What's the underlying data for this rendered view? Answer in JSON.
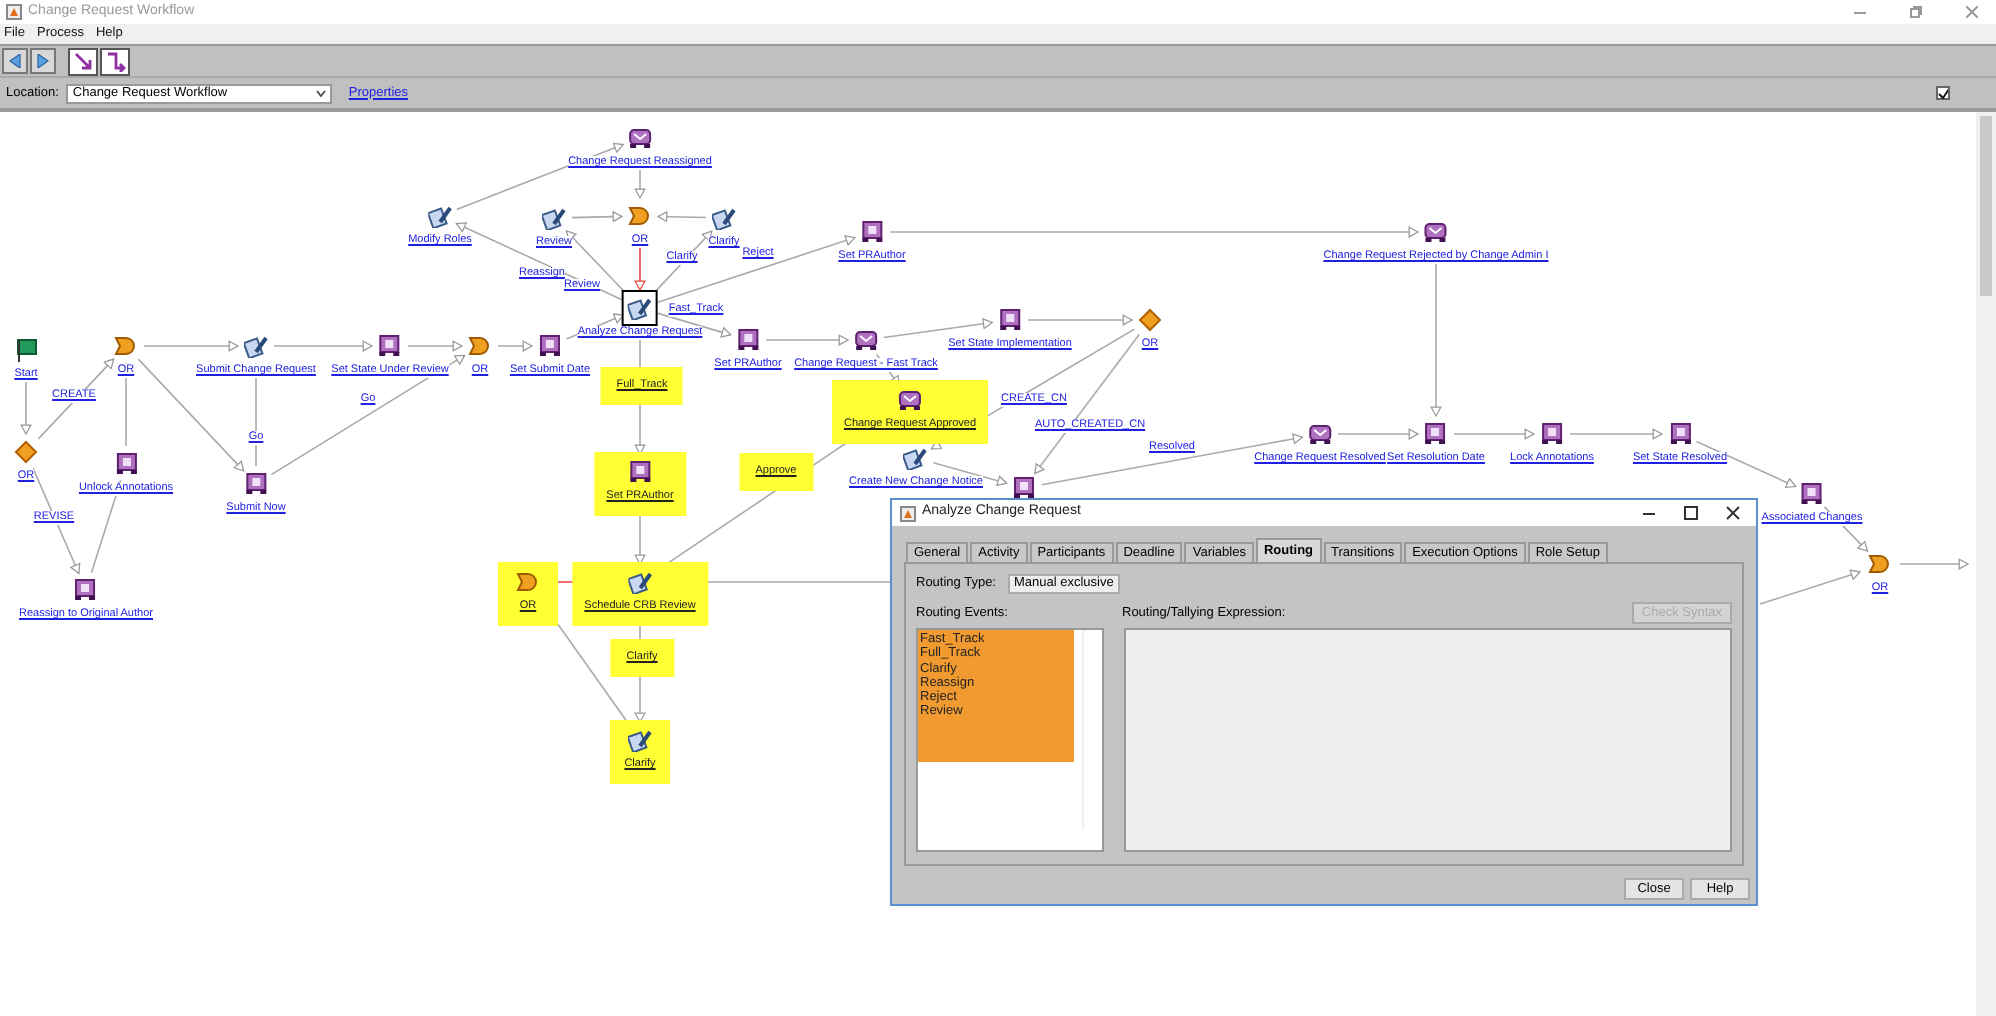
{
  "window": {
    "title": "Change Request Workflow"
  },
  "menu": [
    "File",
    "Process",
    "Help"
  ],
  "location": {
    "label": "Location:",
    "value": "Change Request Workflow",
    "link": "Properties",
    "option_checked": true
  },
  "nodes": [
    {
      "label": "Change Request Reassigned",
      "kind": "notify",
      "highlighted": false,
      "selected": false
    },
    {
      "label": "Modify Roles",
      "kind": "activity",
      "highlighted": false,
      "selected": false
    },
    {
      "label": "Review",
      "kind": "activity",
      "highlighted": false,
      "selected": false
    },
    {
      "label": "OR",
      "kind": "or",
      "highlighted": false,
      "selected": false
    },
    {
      "label": "Clarify",
      "kind": "activity",
      "highlighted": false,
      "selected": false
    },
    {
      "label": "Set PRAuthor",
      "kind": "robot",
      "highlighted": false,
      "selected": false
    },
    {
      "label": "Change Request Rejected by Change Admin I",
      "kind": "notify",
      "highlighted": false,
      "selected": false
    },
    {
      "label": "Analyze Change Request",
      "kind": "activity",
      "highlighted": false,
      "selected": true
    },
    {
      "label": "Set State Implementation",
      "kind": "robot",
      "highlighted": false,
      "selected": false
    },
    {
      "label": "OR",
      "kind": "branch",
      "highlighted": false,
      "selected": false
    },
    {
      "label": "Start",
      "kind": "start",
      "highlighted": false,
      "selected": false
    },
    {
      "label": "OR",
      "kind": "or",
      "highlighted": false,
      "selected": false
    },
    {
      "label": "Submit Change Request",
      "kind": "activity",
      "highlighted": false,
      "selected": false
    },
    {
      "label": "Set State Under Review",
      "kind": "robot",
      "highlighted": false,
      "selected": false
    },
    {
      "label": "OR",
      "kind": "or",
      "highlighted": false,
      "selected": false
    },
    {
      "label": "Set Submit Date",
      "kind": "robot",
      "highlighted": false,
      "selected": false
    },
    {
      "label": "Set PRAuthor",
      "kind": "robot",
      "highlighted": false,
      "selected": false
    },
    {
      "label": "Change Request - Fast Track",
      "kind": "notify",
      "highlighted": false,
      "selected": false
    },
    {
      "label": "Change Request Approved",
      "kind": "notify",
      "highlighted": true,
      "selected": false
    },
    {
      "label": "Change Request Resolved",
      "kind": "notify",
      "highlighted": false,
      "selected": false
    },
    {
      "label": "Set Resolution Date",
      "kind": "robot",
      "highlighted": false,
      "selected": false
    },
    {
      "label": "Lock Annotations",
      "kind": "robot",
      "highlighted": false,
      "selected": false
    },
    {
      "label": "Set State Resolved",
      "kind": "robot",
      "highlighted": false,
      "selected": false
    },
    {
      "label": "OR",
      "kind": "branch",
      "highlighted": false,
      "selected": false
    },
    {
      "label": "Unlock Annotations",
      "kind": "robot",
      "highlighted": false,
      "selected": false
    },
    {
      "label": "Submit Now",
      "kind": "robot",
      "highlighted": false,
      "selected": false
    },
    {
      "label": "Set PRAuthor",
      "kind": "robot",
      "highlighted": true,
      "selected": false
    },
    {
      "label": "Create New Change Notice",
      "kind": "activity",
      "highlighted": false,
      "selected": false
    },
    {
      "kind": "robot",
      "highlighted": false,
      "selected": false
    },
    {
      "label": "Associated Changes",
      "kind": "robot",
      "highlighted": false,
      "selected": false
    },
    {
      "label": "OR",
      "kind": "or",
      "highlighted": false,
      "selected": false
    },
    {
      "label": "Reassign to Original Author",
      "kind": "robot",
      "highlighted": false,
      "selected": false
    },
    {
      "label": "OR",
      "kind": "or",
      "highlighted": true,
      "selected": false
    },
    {
      "label": "Schedule CRB Review",
      "kind": "activity",
      "highlighted": true,
      "selected": false
    },
    {
      "label": "Clarify",
      "kind": "activity",
      "highlighted": true,
      "selected": false
    }
  ],
  "edge_labels": [
    {
      "label": "CREATE",
      "highlighted": false
    },
    {
      "label": "REVISE",
      "highlighted": false
    },
    {
      "label": "Go",
      "highlighted": false
    },
    {
      "label": "Go",
      "highlighted": false
    },
    {
      "label": "Reassign",
      "highlighted": false
    },
    {
      "label": "Review",
      "highlighted": false
    },
    {
      "label": "Clarify",
      "highlighted": false
    },
    {
      "label": "Reject",
      "highlighted": false
    },
    {
      "label": "Fast_Track",
      "highlighted": false
    },
    {
      "label": "Full_Track",
      "highlighted": true
    },
    {
      "label": "Approve",
      "highlighted": true
    },
    {
      "label": "CREATE_CN",
      "highlighted": false
    },
    {
      "label": "AUTO_CREATED_CN",
      "highlighted": false
    },
    {
      "label": "Resolved",
      "highlighted": false
    },
    {
      "label": "Clarify",
      "highlighted": true
    }
  ],
  "dialog": {
    "title": "Analyze Change Request",
    "tabs": [
      {
        "label": "General",
        "selected": false
      },
      {
        "label": "Activity",
        "selected": false
      },
      {
        "label": "Participants",
        "selected": false
      },
      {
        "label": "Deadline",
        "selected": false
      },
      {
        "label": "Variables",
        "selected": false
      },
      {
        "label": "Routing",
        "selected": true
      },
      {
        "label": "Transitions",
        "selected": false
      },
      {
        "label": "Execution Options",
        "selected": false
      },
      {
        "label": "Role Setup",
        "selected": false
      }
    ],
    "routing_type": {
      "label": "Routing Type:",
      "value": "Manual exclusive"
    },
    "routing_events_label": "Routing Events:",
    "routing_events": [
      {
        "label": "Fast_Track",
        "selected": true
      },
      {
        "label": "Full_Track",
        "selected": true
      },
      {
        "label": "Clarify",
        "selected": true
      },
      {
        "label": "Reassign",
        "selected": true
      },
      {
        "label": "Reject",
        "selected": true
      },
      {
        "label": "Review",
        "selected": true
      }
    ],
    "expression_label": "Routing/Tallying Expression:",
    "check_syntax": {
      "label": "Check Syntax",
      "disabled": true
    },
    "buttons": [
      "Close",
      "Help"
    ]
  }
}
